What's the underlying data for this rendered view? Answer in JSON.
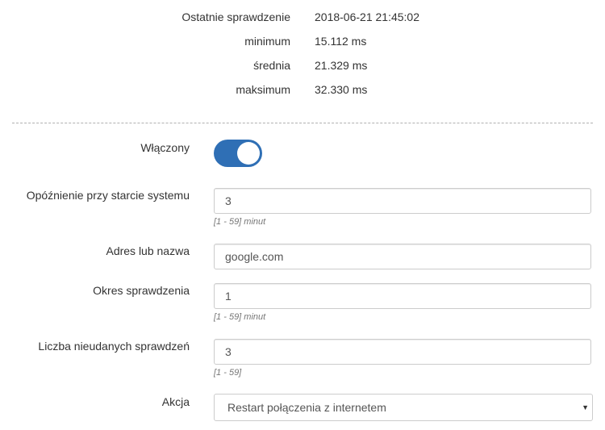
{
  "stats": {
    "last_check": {
      "label": "Ostatnie sprawdzenie",
      "value": "2018-06-21 21:45:02"
    },
    "minimum": {
      "label": "minimum",
      "value": "15.112 ms"
    },
    "average": {
      "label": "średnia",
      "value": "21.329 ms"
    },
    "maximum": {
      "label": "maksimum",
      "value": "32.330 ms"
    }
  },
  "form": {
    "enabled": {
      "label": "Włączony",
      "state": "on"
    },
    "startup_delay": {
      "label": "Opóźnienie przy starcie systemu",
      "value": "3",
      "hint": "[1 - 59] minut"
    },
    "address": {
      "label": "Adres lub nazwa",
      "value": "google.com"
    },
    "check_period": {
      "label": "Okres sprawdzenia",
      "value": "1",
      "hint": "[1 - 59] minut"
    },
    "failed_checks": {
      "label": "Liczba nieudanych sprawdzeń",
      "value": "3",
      "hint": "[1 - 59]"
    },
    "action": {
      "label": "Akcja",
      "selected": "Restart połączenia z internetem"
    }
  },
  "icons": {
    "select_arrow": "caret-down-icon"
  },
  "colors": {
    "toggle_on": "#2f6fb5"
  }
}
